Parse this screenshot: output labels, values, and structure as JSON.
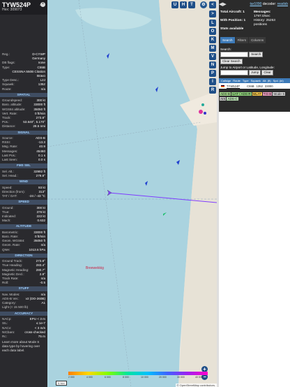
{
  "infoblock": {
    "callsign": "TYW524P",
    "hex": "Hex: 309073",
    "rows_top": [
      {
        "k": "Reg.:",
        "v": "D-CYWP"
      },
      {
        "k": "",
        "v": "Germany"
      },
      {
        "k": "DB flags:",
        "v": "none"
      },
      {
        "k": "Type:",
        "v": "C55B"
      },
      {
        "k": "",
        "v": "CESSNA 550B Citation"
      },
      {
        "k": "",
        "v": "Bravo"
      },
      {
        "k": "Type Desc.:",
        "v": "L2J"
      },
      {
        "k": "Squawk:",
        "v": "1352"
      },
      {
        "k": "Route:",
        "v": "n/a"
      }
    ],
    "spatial_title": "SPATIAL",
    "spatial": [
      {
        "k": "Groundspeed:",
        "v": "300 kt"
      },
      {
        "k": "Baro. altitude:",
        "v": "33000 ft"
      },
      {
        "k": "WGS84 altitude:",
        "v": "35050 ft"
      },
      {
        "k": "Vert. Rate:",
        "v": "0 ft/min"
      },
      {
        "k": "Track:",
        "v": "273.8°"
      },
      {
        "k": "Pos.:",
        "v": "53.640°, 5.170°"
      },
      {
        "k": "Distance:",
        "v": "28.5 nmi"
      }
    ],
    "signal_title": "SIGNAL",
    "signal": [
      {
        "k": "Source:",
        "v": "ADS-B"
      },
      {
        "k": "RSSI:",
        "v": "-13.3"
      },
      {
        "k": "Msg. Rate:",
        "v": "40.9"
      },
      {
        "k": "Messages:",
        "v": "45460"
      },
      {
        "k": "Last Pos.:",
        "v": "0.1 s"
      },
      {
        "k": "Last Seen:",
        "v": "0.0 s"
      }
    ],
    "fms_title": "FMS SEL",
    "fms": [
      {
        "k": "Sel. Alt.:",
        "v": "32992 ft"
      },
      {
        "k": "Sel. Head.:",
        "v": "279.8°"
      }
    ],
    "wind_title": "WIND",
    "wind": [
      {
        "k": "Speed:",
        "v": "93 kt"
      },
      {
        "k": "Direction (from):",
        "v": "313°"
      },
      {
        "k": "TAT / OAT:",
        "v": "-24 / -43 °C"
      }
    ],
    "speed_title": "SPEED",
    "speed": [
      {
        "k": "Ground:",
        "v": "300 kt"
      },
      {
        "k": "True:",
        "v": "376 kt"
      },
      {
        "k": "Indicated:",
        "v": "222 kt"
      },
      {
        "k": "Mach:",
        "v": "0.632"
      }
    ],
    "altitude_title": "ALTITUDE",
    "altitude": [
      {
        "k": "Barometric:",
        "v": "33000 ft"
      },
      {
        "k": "Baro. Rate:",
        "v": "0 ft/min"
      },
      {
        "k": "Geom. WGS84:",
        "v": "35050 ft"
      },
      {
        "k": "Geom. Rate:",
        "v": "n/a"
      },
      {
        "k": "QNH:",
        "v": "1013.6 hPa"
      }
    ],
    "direction_title": "DIRECTION",
    "direction": [
      {
        "k": "Ground Track:",
        "v": "273.8°"
      },
      {
        "k": "True Heading:",
        "v": "283.4°"
      },
      {
        "k": "Magnetic Heading:",
        "v": "280.7°"
      },
      {
        "k": "Magnetic Decl.:",
        "v": "2.8°"
      },
      {
        "k": "Track Rate:",
        "v": "n/a"
      },
      {
        "k": "Roll:",
        "v": "-0.5"
      }
    ],
    "stuff_title": "STUFF",
    "stuff": [
      {
        "k": "Nav. Modes:",
        "v": "n/a"
      },
      {
        "k": "ADS-B Ver.:",
        "v": "v2 (DO-260B)"
      },
      {
        "k": "Category:",
        "v": "A1"
      },
      {
        "k": "Light (< 15 500 lb)",
        "v": ""
      }
    ],
    "accuracy_title": "ACCURACY",
    "accuracy": [
      {
        "k": "NACp:",
        "v": "EPU < 3 m"
      },
      {
        "k": "SIL:",
        "v": "≤ 1e-7"
      },
      {
        "k": "NACv:",
        "v": "< 3 m/s"
      },
      {
        "k": "NICbaro:",
        "v": "cross-checked"
      },
      {
        "k": "Rc:",
        "v": "75 m"
      }
    ],
    "note": "Learn more about Mode S data type by hovering over each data label."
  },
  "map": {
    "map_buttons": [
      "U",
      "H",
      "T"
    ],
    "side_buttons": [
      "<",
      ">",
      "L",
      "O",
      "K",
      "M",
      "P",
      "I",
      "R"
    ],
    "extra_side": [
      "V",
      "N"
    ],
    "zoom_in": "+",
    "zoom_out": "−",
    "scale": "5 NM",
    "place_label": "Breewekkig",
    "attribution": "© OpenStreetMap contributors.",
    "alt_labels": [
      "2 000",
      "4 000",
      "6 000",
      "8 000",
      "10 000",
      "20 000",
      "30 000",
      "40 000+"
    ]
  },
  "sidebar": {
    "nav_arrows": "◀▶",
    "link_text": "tar1090",
    "decoder_text": "decoder:",
    "decoder_value": "readsb",
    "total_aircraft": "Total Aircraft: 1",
    "with_position": "With Position: 1",
    "stats_available": "Stats available",
    "messages": "Messages:",
    "msg_rate": "1797.0/sec",
    "history": "History: 25253",
    "positions": "positions",
    "tabs": [
      "Search",
      "Filters",
      "Columns"
    ],
    "search_label": "Search:",
    "search_button": "Search",
    "clear_search": "Clear Search",
    "jump_label": "Jump to Airport or Latitude, Longitude:",
    "jump_button": "Jump",
    "clear_button": "Clear",
    "columns": [
      "Callsign",
      "Route",
      "Type",
      "Squawk",
      "Alt. (ft)",
      "Spd. (kt)"
    ],
    "row": {
      "callsign": "TYW524P",
      "type": "C55B",
      "squawk": "1352",
      "alt": "33000"
    },
    "legend": [
      {
        "label": "ADS-B",
        "color": "#a4d98c"
      },
      {
        "label": "UAT / ADS-R",
        "color": "#8fd17b"
      },
      {
        "label": "MLAT",
        "color": "#f4c54a"
      },
      {
        "label": "TIS-B",
        "color": "#f2a0c4"
      },
      {
        "label": "Mode-S",
        "color": "#d9d9d9"
      },
      {
        "label": "AIS",
        "color": "#c6c6c6"
      },
      {
        "label": "ADS-C",
        "color": "#b8e0b2"
      }
    ]
  }
}
